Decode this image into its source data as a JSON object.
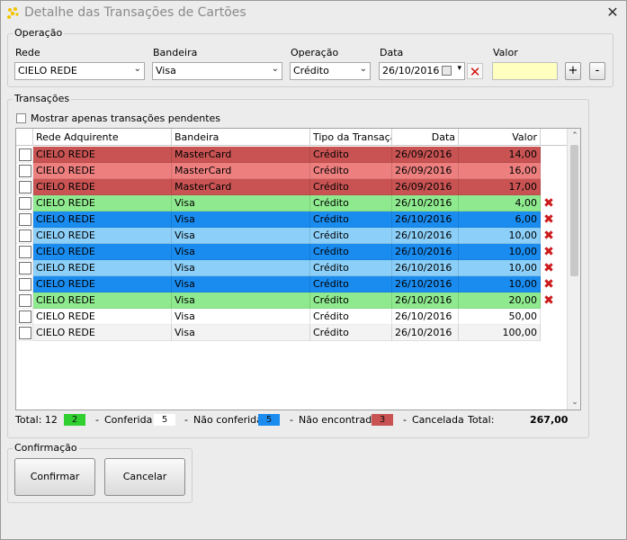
{
  "window": {
    "title": "Detalhe das Transações de Cartões",
    "close_glyph": "✕"
  },
  "operacao": {
    "legend": "Operação",
    "rede_label": "Rede",
    "rede_value": "CIELO REDE",
    "bandeira_label": "Bandeira",
    "bandeira_value": "Visa",
    "operacao_label": "Operação",
    "operacao_value": "Crédito",
    "data_label": "Data",
    "data_value": "26/10/2016",
    "valor_label": "Valor",
    "valor_value": "",
    "plus_label": "+",
    "minus_label": "-"
  },
  "transacoes": {
    "legend": "Transações",
    "pending_only_label": "Mostrar apenas transações pendentes",
    "columns": [
      "Rede Adquirente",
      "Bandeira",
      "Tipo da Transação",
      "Data",
      "Valor"
    ],
    "rows": [
      {
        "rede": "CIELO REDE",
        "bandeira": "MasterCard",
        "tipo": "Crédito",
        "data": "26/09/2016",
        "valor": "14,00",
        "status": "cancelada_dark",
        "deletable": false
      },
      {
        "rede": "CIELO REDE",
        "bandeira": "MasterCard",
        "tipo": "Crédito",
        "data": "26/09/2016",
        "valor": "16,00",
        "status": "cancelada_light",
        "deletable": false
      },
      {
        "rede": "CIELO REDE",
        "bandeira": "MasterCard",
        "tipo": "Crédito",
        "data": "26/09/2016",
        "valor": "17,00",
        "status": "cancelada_dark",
        "deletable": false
      },
      {
        "rede": "CIELO REDE",
        "bandeira": "Visa",
        "tipo": "Crédito",
        "data": "26/10/2016",
        "valor": "4,00",
        "status": "conferida",
        "deletable": true
      },
      {
        "rede": "CIELO REDE",
        "bandeira": "Visa",
        "tipo": "Crédito",
        "data": "26/10/2016",
        "valor": "6,00",
        "status": "nao_encontrada_dark",
        "deletable": true
      },
      {
        "rede": "CIELO REDE",
        "bandeira": "Visa",
        "tipo": "Crédito",
        "data": "26/10/2016",
        "valor": "10,00",
        "status": "nao_encontrada_light",
        "deletable": true
      },
      {
        "rede": "CIELO REDE",
        "bandeira": "Visa",
        "tipo": "Crédito",
        "data": "26/10/2016",
        "valor": "10,00",
        "status": "nao_encontrada_dark",
        "deletable": true
      },
      {
        "rede": "CIELO REDE",
        "bandeira": "Visa",
        "tipo": "Crédito",
        "data": "26/10/2016",
        "valor": "10,00",
        "status": "nao_encontrada_light",
        "deletable": true
      },
      {
        "rede": "CIELO REDE",
        "bandeira": "Visa",
        "tipo": "Crédito",
        "data": "26/10/2016",
        "valor": "10,00",
        "status": "nao_encontrada_dark",
        "deletable": true
      },
      {
        "rede": "CIELO REDE",
        "bandeira": "Visa",
        "tipo": "Crédito",
        "data": "26/10/2016",
        "valor": "20,00",
        "status": "conferida",
        "deletable": true
      },
      {
        "rede": "CIELO REDE",
        "bandeira": "Visa",
        "tipo": "Crédito",
        "data": "26/10/2016",
        "valor": "50,00",
        "status": "none",
        "deletable": false
      },
      {
        "rede": "CIELO REDE",
        "bandeira": "Visa",
        "tipo": "Crédito",
        "data": "26/10/2016",
        "valor": "100,00",
        "status": "none_alt",
        "deletable": false
      }
    ]
  },
  "status_colors": {
    "cancelada_dark": "#c95353",
    "cancelada_light": "#ee7f7f",
    "conferida": "#8fea8f",
    "nao_encontrada_dark": "#1a8cf0",
    "nao_encontrada_light": "#8ccff8",
    "none": "#ffffff",
    "none_alt": "#f3f3f3"
  },
  "footer": {
    "total_label": "Total: 12",
    "conferida_count": "2",
    "conferida_label": "Conferida",
    "nao_conferida_count": "5",
    "nao_conferida_label": "Não conferida",
    "nao_encontrada_count": "5",
    "nao_encontrada_label": "Não encontrada",
    "cancelada_count": "3",
    "cancelada_label": "Cancelada",
    "dash": "-",
    "total_value_label": "Total:",
    "total_value": "267,00"
  },
  "confirmacao": {
    "legend": "Confirmação",
    "confirmar_label": "Confirmar",
    "cancelar_label": "Cancelar"
  },
  "icons": {
    "app": "star-icon",
    "delete": "red-x-icon",
    "close": "close-icon"
  }
}
